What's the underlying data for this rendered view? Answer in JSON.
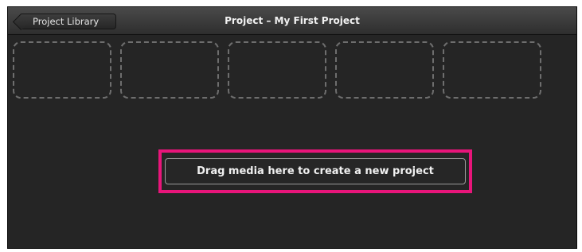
{
  "toolbar": {
    "back_label": "Project Library",
    "title": "Project – My First Project"
  },
  "placeholders": {
    "count": 5
  },
  "drop_zone": {
    "label": "Drag media here to create a new project"
  },
  "colors": {
    "background": "#252525",
    "toolbar": "#3a3a3a",
    "highlight": "#e8157a",
    "placeholder_border": "#6e6e6e",
    "text": "#f0f0f0"
  }
}
